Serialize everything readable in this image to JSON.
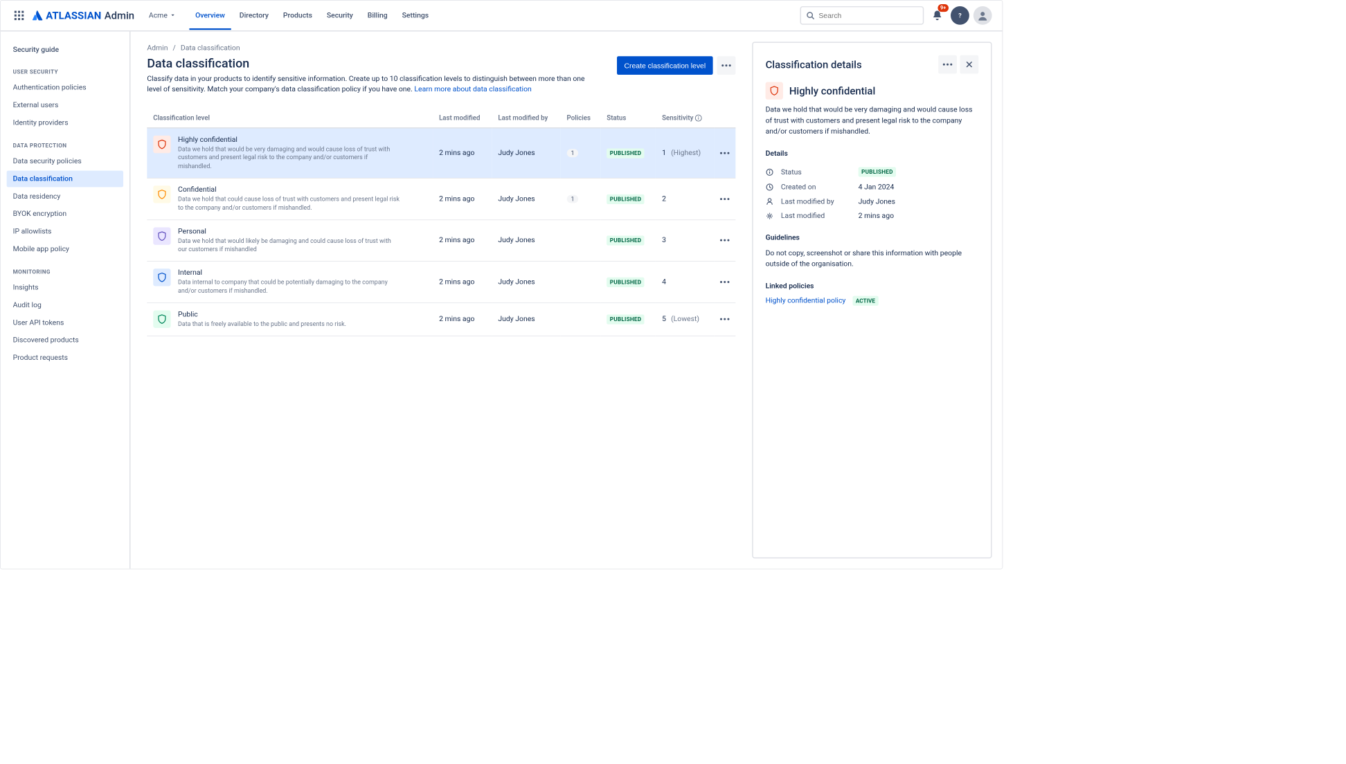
{
  "topnav": {
    "logo_text": "ATLASSIAN",
    "logo_suffix": "Admin",
    "org_name": "Acme",
    "tabs": [
      "Overview",
      "Directory",
      "Products",
      "Security",
      "Billing",
      "Settings"
    ],
    "active_tab": "Overview",
    "search_placeholder": "Search",
    "notif_count": "9+"
  },
  "sidebar": {
    "top_link": "Security guide",
    "groups": [
      {
        "title": "USER SECURITY",
        "items": [
          "Authentication policies",
          "External users",
          "Identity providers"
        ]
      },
      {
        "title": "DATA PROTECTION",
        "items": [
          "Data security policies",
          "Data classification",
          "Data residency",
          "BYOK encryption",
          "IP allowlists",
          "Mobile app policy"
        ]
      },
      {
        "title": "MONITORING",
        "items": [
          "Insights",
          "Audit log",
          "User API tokens",
          "Discovered products",
          "Product requests"
        ]
      }
    ],
    "active_item": "Data classification"
  },
  "breadcrumb": {
    "root": "Admin",
    "current": "Data classification"
  },
  "page": {
    "title": "Data classification",
    "desc": "Classify data in your products to identify sensitive information. Create up to 10 classification levels to distinguish between more than one level of sensitivity. Match your company's data classification policy if you have one. ",
    "learn_more": "Learn more about data classification",
    "create_button": "Create classification level"
  },
  "table": {
    "columns": [
      "Classification level",
      "Last modified",
      "Last modified by",
      "Policies",
      "Status",
      "Sensitivity"
    ],
    "rows": [
      {
        "name": "Highly confidential",
        "desc": "Data we hold that would be very damaging and would cause loss of trust with customers and present legal risk to the company and/or customers if mishandled.",
        "shield": "red",
        "modified": "2 mins ago",
        "by": "Judy Jones",
        "policies": "1",
        "status": "PUBLISHED",
        "sensitivity": "1",
        "sens_label": "(Highest)",
        "selected": true
      },
      {
        "name": "Confidential",
        "desc": "Data we hold that could cause loss of trust with customers and present legal risk to the company and/or customers if mishandled.",
        "shield": "yellow",
        "modified": "2 mins ago",
        "by": "Judy Jones",
        "policies": "1",
        "status": "PUBLISHED",
        "sensitivity": "2",
        "sens_label": ""
      },
      {
        "name": "Personal",
        "desc": "Data we hold that would likely be damaging and could cause loss of trust with our customers if mishandled",
        "shield": "purple",
        "modified": "2 mins ago",
        "by": "Judy Jones",
        "policies": "",
        "status": "PUBLISHED",
        "sensitivity": "3",
        "sens_label": ""
      },
      {
        "name": "Internal",
        "desc": "Data internal to company that could be potentially damaging to the company and/or customers if mishandled.",
        "shield": "blue",
        "modified": "2 mins ago",
        "by": "Judy Jones",
        "policies": "",
        "status": "PUBLISHED",
        "sensitivity": "4",
        "sens_label": ""
      },
      {
        "name": "Public",
        "desc": "Data that is freely available to the public and presents no risk.",
        "shield": "green",
        "modified": "2 mins ago",
        "by": "Judy Jones",
        "policies": "",
        "status": "PUBLISHED",
        "sensitivity": "5",
        "sens_label": "(Lowest)"
      }
    ]
  },
  "details": {
    "panel_title": "Classification details",
    "name": "Highly confidential",
    "shield": "red",
    "desc": "Data we hold that would be very damaging and would cause loss of trust with customers and present legal risk to the company and/or customers if mishandled.",
    "details_title": "Details",
    "status_label": "Status",
    "status_value": "PUBLISHED",
    "created_label": "Created on",
    "created_value": "4 Jan 2024",
    "modified_by_label": "Last modified by",
    "modified_by_value": "Judy Jones",
    "modified_label": "Last modified",
    "modified_value": "2 mins ago",
    "guidelines_title": "Guidelines",
    "guidelines_text": "Do not copy, screenshot or share this information with people outside of the organisation.",
    "linked_title": "Linked policies",
    "linked_policy": "Highly confidential policy",
    "linked_status": "ACTIVE"
  }
}
